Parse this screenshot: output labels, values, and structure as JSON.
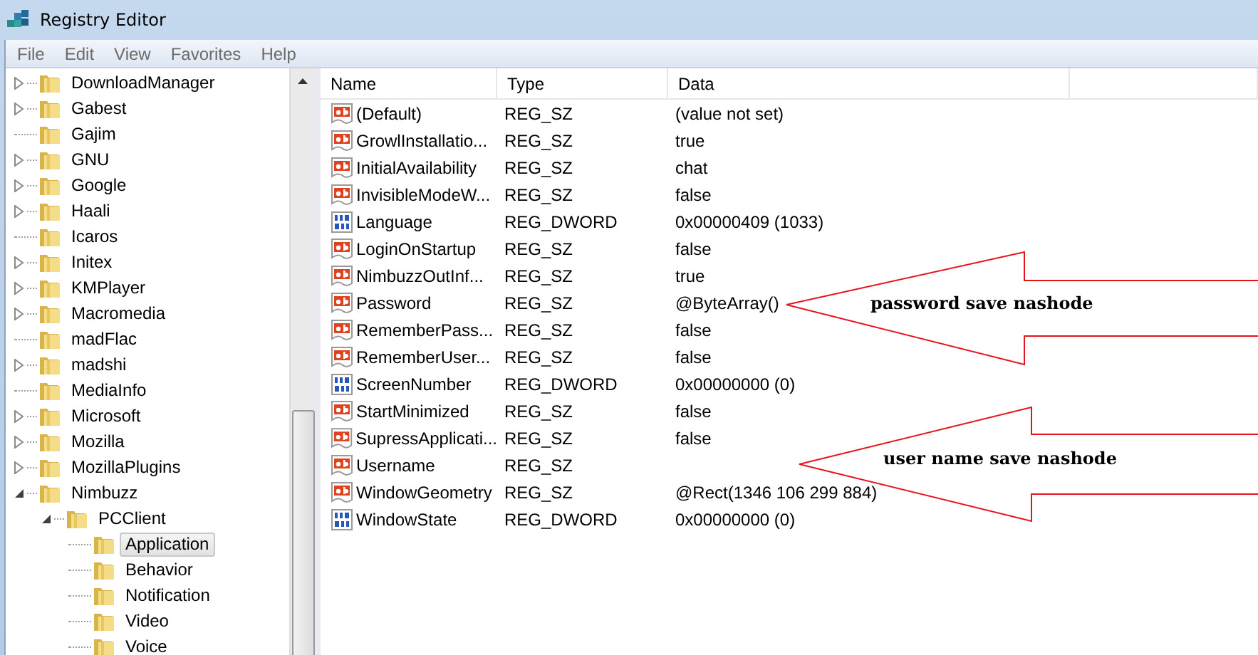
{
  "window": {
    "title": "Registry Editor"
  },
  "menu": [
    "File",
    "Edit",
    "View",
    "Favorites",
    "Help"
  ],
  "tree": [
    {
      "label": "DownloadManager",
      "kind": "collapsed",
      "selected": false
    },
    {
      "label": "Gabest",
      "kind": "collapsed",
      "selected": false
    },
    {
      "label": "Gajim",
      "kind": "leaf",
      "selected": false
    },
    {
      "label": "GNU",
      "kind": "collapsed",
      "selected": false
    },
    {
      "label": "Google",
      "kind": "collapsed",
      "selected": false
    },
    {
      "label": "Haali",
      "kind": "collapsed",
      "selected": false
    },
    {
      "label": "Icaros",
      "kind": "leaf",
      "selected": false
    },
    {
      "label": "Initex",
      "kind": "collapsed",
      "selected": false
    },
    {
      "label": "KMPlayer",
      "kind": "collapsed",
      "selected": false
    },
    {
      "label": "Macromedia",
      "kind": "collapsed",
      "selected": false
    },
    {
      "label": "madFlac",
      "kind": "leaf",
      "selected": false
    },
    {
      "label": "madshi",
      "kind": "collapsed",
      "selected": false
    },
    {
      "label": "MediaInfo",
      "kind": "leaf",
      "selected": false
    },
    {
      "label": "Microsoft",
      "kind": "collapsed",
      "selected": false
    },
    {
      "label": "Mozilla",
      "kind": "collapsed",
      "selected": false
    },
    {
      "label": "MozillaPlugins",
      "kind": "collapsed",
      "selected": false
    },
    {
      "label": "Nimbuzz",
      "kind": "expanded",
      "selected": false,
      "children": [
        {
          "label": "PCClient",
          "kind": "expanded",
          "selected": false,
          "children": [
            {
              "label": "Application",
              "kind": "leaf",
              "selected": true
            },
            {
              "label": "Behavior",
              "kind": "leaf",
              "selected": false
            },
            {
              "label": "Notification",
              "kind": "leaf",
              "selected": false
            },
            {
              "label": "Video",
              "kind": "leaf",
              "selected": false
            },
            {
              "label": "Voice",
              "kind": "leaf",
              "selected": false
            }
          ]
        }
      ]
    }
  ],
  "table": {
    "columns": [
      "Name",
      "Type",
      "Data"
    ],
    "rows": [
      {
        "kind": "sz",
        "name": "(Default)",
        "type": "REG_SZ",
        "data": "(value not set)"
      },
      {
        "kind": "sz",
        "name": "GrowlInstallatio...",
        "type": "REG_SZ",
        "data": "true"
      },
      {
        "kind": "sz",
        "name": "InitialAvailability",
        "type": "REG_SZ",
        "data": "chat"
      },
      {
        "kind": "sz",
        "name": "InvisibleModeW...",
        "type": "REG_SZ",
        "data": "false"
      },
      {
        "kind": "dword",
        "name": "Language",
        "type": "REG_DWORD",
        "data": "0x00000409 (1033)"
      },
      {
        "kind": "sz",
        "name": "LoginOnStartup",
        "type": "REG_SZ",
        "data": "false"
      },
      {
        "kind": "sz",
        "name": "NimbuzzOutInf...",
        "type": "REG_SZ",
        "data": "true"
      },
      {
        "kind": "sz",
        "name": "Password",
        "type": "REG_SZ",
        "data": "@ByteArray()"
      },
      {
        "kind": "sz",
        "name": "RememberPass...",
        "type": "REG_SZ",
        "data": "false"
      },
      {
        "kind": "sz",
        "name": "RememberUser...",
        "type": "REG_SZ",
        "data": "false"
      },
      {
        "kind": "dword",
        "name": "ScreenNumber",
        "type": "REG_DWORD",
        "data": "0x00000000 (0)"
      },
      {
        "kind": "sz",
        "name": "StartMinimized",
        "type": "REG_SZ",
        "data": "false"
      },
      {
        "kind": "sz",
        "name": "SupressApplicati...",
        "type": "REG_SZ",
        "data": "false"
      },
      {
        "kind": "sz",
        "name": "Username",
        "type": "REG_SZ"
      },
      {
        "kind": "sz",
        "name": "WindowGeometry",
        "type": "REG_SZ",
        "data": "@Rect(1346 106 299 884)"
      },
      {
        "kind": "dword",
        "name": "WindowState",
        "type": "REG_DWORD",
        "data": "0x00000000 (0)"
      }
    ]
  },
  "annotations": [
    {
      "text": "password save nashode"
    },
    {
      "text": "user name save nashode"
    }
  ]
}
